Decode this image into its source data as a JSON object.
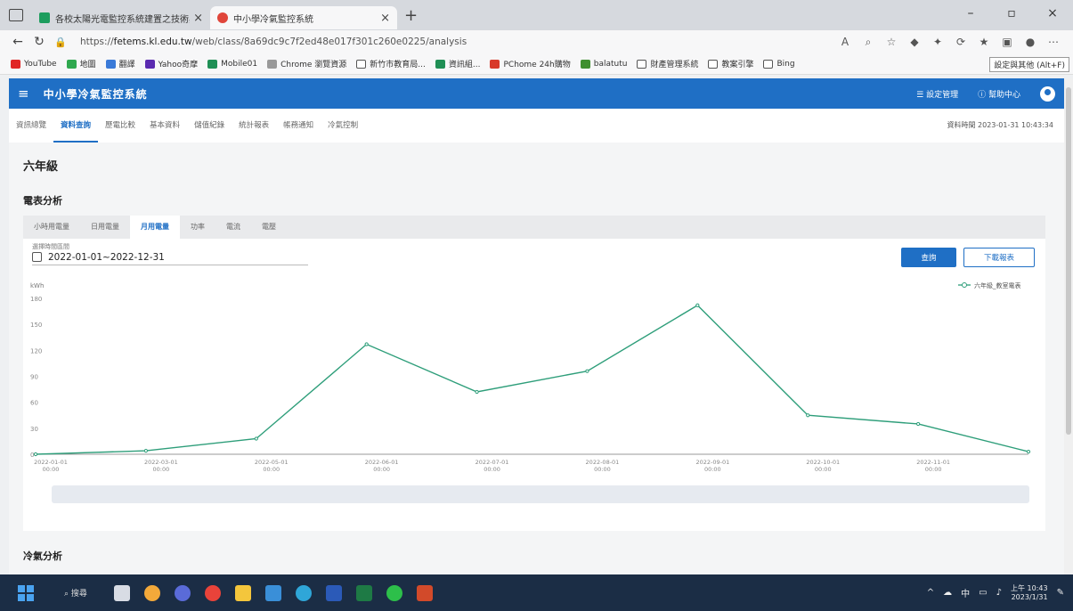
{
  "browser": {
    "tabs": [
      {
        "title": "各校太陽光電監控系統建置之技術與民眾...",
        "active": false
      },
      {
        "title": "中小學冷氣監控系統",
        "active": true
      }
    ],
    "url_prefix": "https://",
    "url_domain": "fetems.kl.edu.tw",
    "url_path": "/web/class/8a69dc9c7f2ed48e017f301c260e0225/analysis",
    "bookmarks": [
      "YouTube",
      "地圖",
      "翻譯",
      "Yahoo奇摩",
      "Mobile01",
      "Chrome 瀏覽資源",
      "新竹市教育局...",
      "資訊組...",
      "PChome 24h購物",
      "balatutu",
      "財產管理系統",
      "教案引擎",
      "Bing"
    ],
    "bookmarks_more": "設定與其他 (Alt+F)"
  },
  "app": {
    "title": "中小學冷氣監控系統",
    "settings_label": "設定管理",
    "help_label": "幫助中心",
    "menu": [
      "資訊總覽",
      "資料查詢",
      "歷電比較",
      "基本資料",
      "儲值紀錄",
      "統計報表",
      "帳務通知",
      "冷氣控制"
    ],
    "active_menu": "資料查詢",
    "update_time": "資料時間 2023-01-31 10:43:34"
  },
  "page": {
    "title": "六年級",
    "section_title": "電表分析",
    "subtabs": [
      "小時用電量",
      "日用電量",
      "月用電量",
      "功率",
      "電流",
      "電壓"
    ],
    "active_subtab": "月用電量",
    "range_label": "選擇時間區間",
    "range_value": "2022-01-01~2022-12-31",
    "query_button": "查詢",
    "download_button": "下載報表",
    "section2_title": "冷氣分析"
  },
  "chart_data": {
    "type": "line",
    "ylabel": "kWh",
    "ylim": [
      0,
      180
    ],
    "yticks": [
      0,
      30,
      60,
      90,
      120,
      150,
      180
    ],
    "x": [
      "2022-01-01 00:00",
      "2022-03-01 00:00",
      "2022-05-01 00:00",
      "2022-06-01 00:00",
      "2022-07-01 00:00",
      "2022-08-01 00:00",
      "2022-09-01 00:00",
      "2022-10-01 00:00",
      "2022-11-01 00:00",
      "2022-12-01 00:00"
    ],
    "xlabels": [
      "2022-01-01 00:00",
      "2022-03-01 00:00",
      "2022-05-01 00:00",
      "2022-06-01 00:00",
      "2022-07-01 00:00",
      "2022-08-01 00:00",
      "2022-09-01 00:00",
      "2022-10-01 00:00",
      "2022-11-01 00:00"
    ],
    "series": [
      {
        "name": "六年級_教室電表",
        "values": [
          0,
          4,
          18,
          127,
          72,
          96,
          172,
          45,
          35,
          3
        ],
        "color": "#2e9e7a"
      }
    ],
    "legend": "top-right",
    "grid": false
  },
  "taskbar": {
    "search_label": "搜尋",
    "ime": "中",
    "time": "上午 10:43",
    "date": "2023/1/31"
  }
}
